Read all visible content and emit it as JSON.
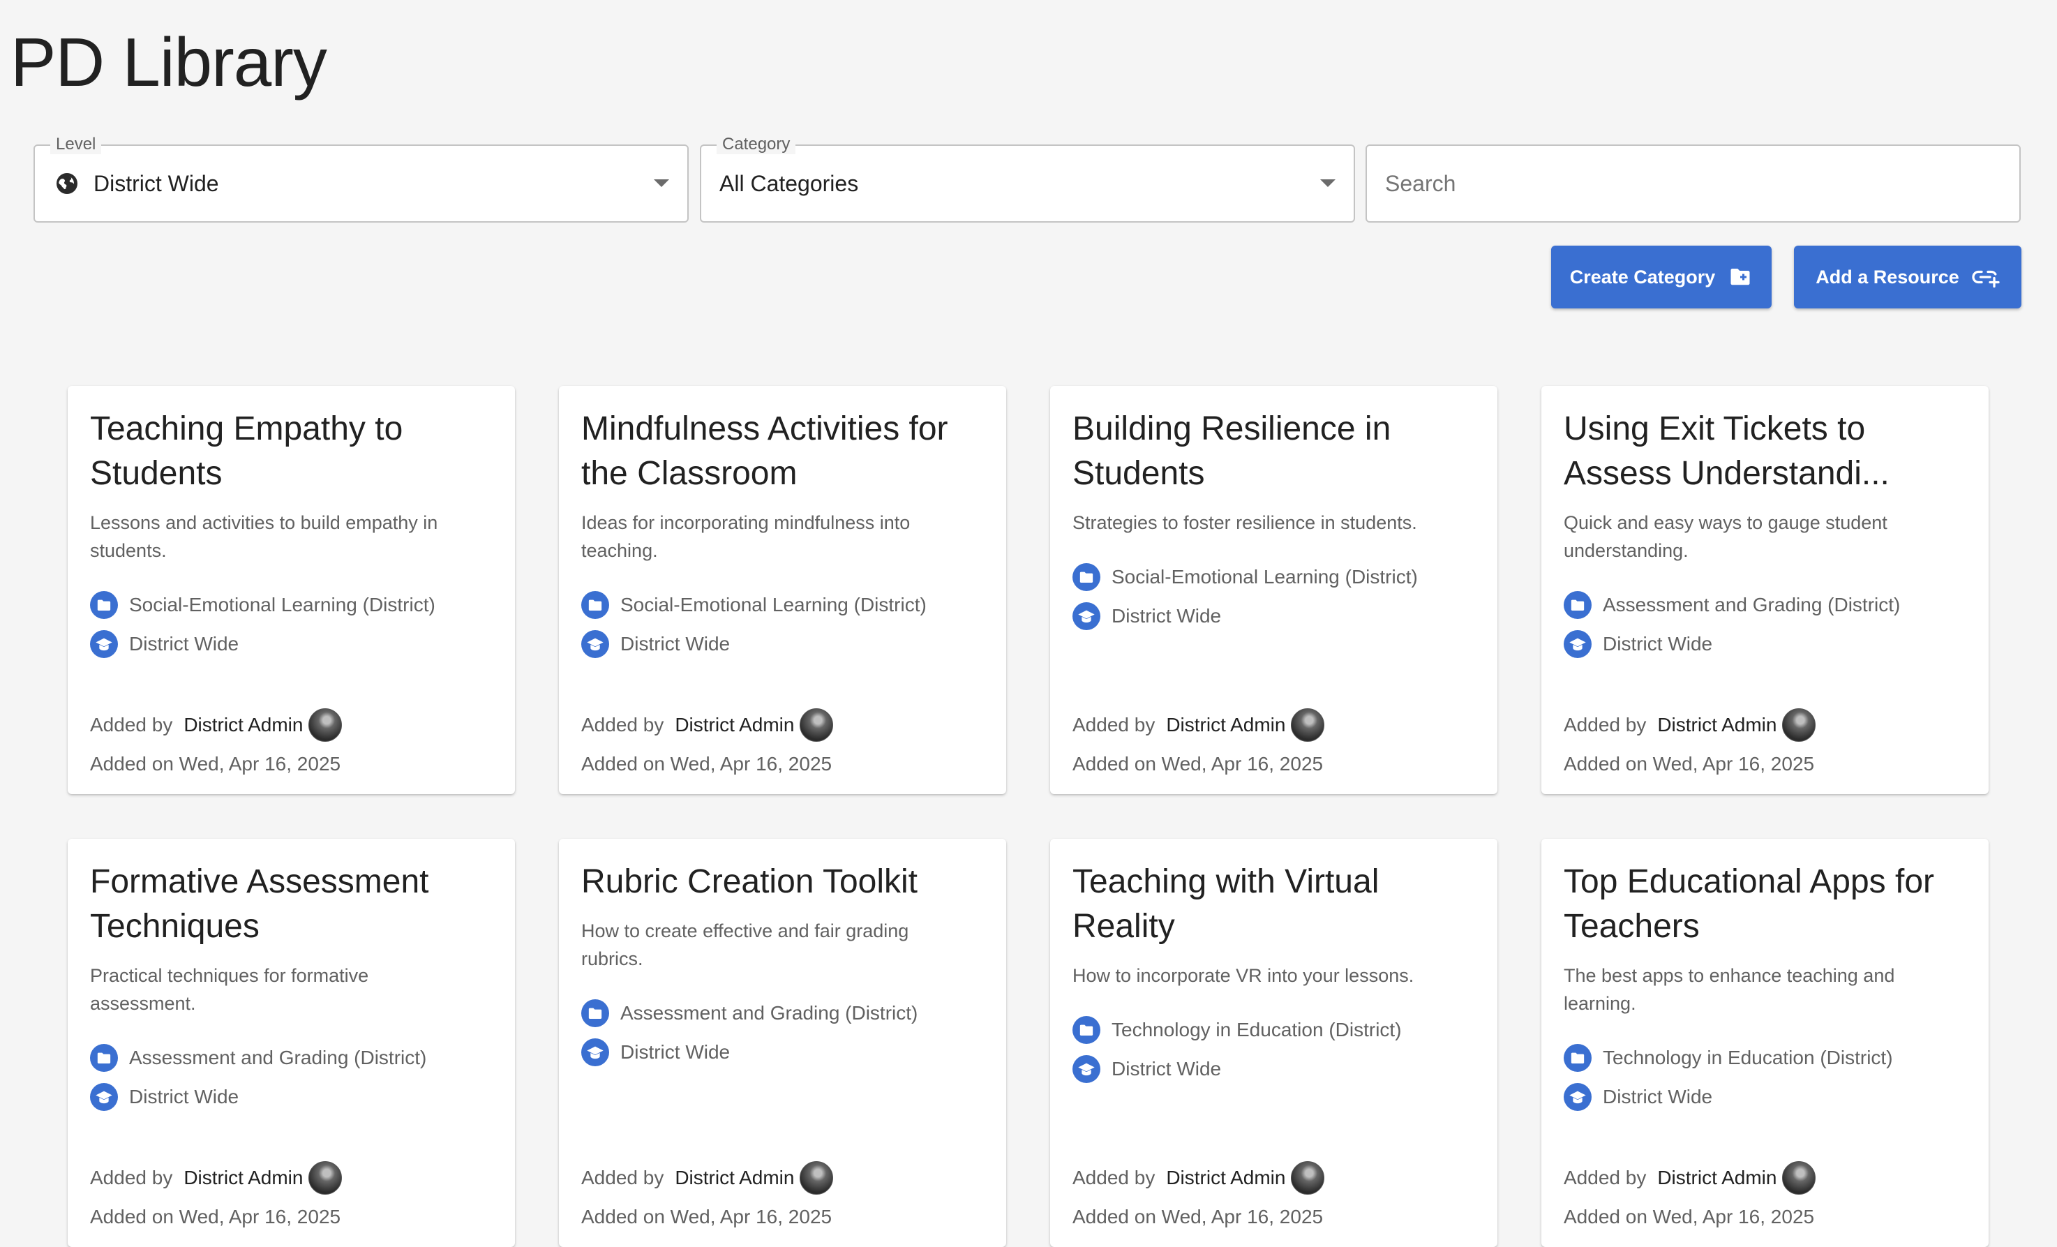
{
  "page": {
    "title": "PD Library"
  },
  "filters": {
    "level": {
      "label": "Level",
      "value": "District Wide"
    },
    "category": {
      "label": "Category",
      "value": "All Categories"
    },
    "search": {
      "placeholder": "Search",
      "value": ""
    }
  },
  "actions": {
    "create_category": "Create Category",
    "add_resource": "Add a Resource"
  },
  "colors": {
    "accent": "#3a6fd1",
    "background": "#f5f5f5"
  },
  "icons": {
    "level": "globe-icon",
    "create_category": "folder-plus-icon",
    "add_resource": "link-plus-icon",
    "category": "folder-icon",
    "level_badge": "graduation-cap-icon"
  },
  "cards": [
    {
      "title": "Teaching Empathy to\nStudents",
      "description": "Lessons and activities to build empathy in\nstudents.",
      "category": "Social-Emotional Learning (District)",
      "level": "District Wide",
      "added_by_label": "Added by",
      "added_by": "District Admin",
      "added_on": "Added on Wed, Apr 16, 2025"
    },
    {
      "title": "Mindfulness Activities for\nthe Classroom",
      "description": "Ideas for incorporating mindfulness into\nteaching.",
      "category": "Social-Emotional Learning (District)",
      "level": "District Wide",
      "added_by_label": "Added by",
      "added_by": "District Admin",
      "added_on": "Added on Wed, Apr 16, 2025"
    },
    {
      "title": "Building Resilience in\nStudents",
      "description": "Strategies to foster resilience in students.",
      "category": "Social-Emotional Learning (District)",
      "level": "District Wide",
      "added_by_label": "Added by",
      "added_by": "District Admin",
      "added_on": "Added on Wed, Apr 16, 2025"
    },
    {
      "title": "Using Exit Tickets to\nAssess Understandi...",
      "description": "Quick and easy ways to gauge student\nunderstanding.",
      "category": "Assessment and Grading (District)",
      "level": "District Wide",
      "added_by_label": "Added by",
      "added_by": "District Admin",
      "added_on": "Added on Wed, Apr 16, 2025"
    },
    {
      "title": "Formative Assessment\nTechniques",
      "description": "Practical techniques for formative\nassessment.",
      "category": "Assessment and Grading (District)",
      "level": "District Wide",
      "added_by_label": "Added by",
      "added_by": "District Admin",
      "added_on": "Added on Wed, Apr 16, 2025"
    },
    {
      "title": "Rubric Creation Toolkit",
      "description": "How to create effective and fair grading\nrubrics.",
      "category": "Assessment and Grading (District)",
      "level": "District Wide",
      "added_by_label": "Added by",
      "added_by": "District Admin",
      "added_on": "Added on Wed, Apr 16, 2025"
    },
    {
      "title": "Teaching with Virtual\nReality",
      "description": "How to incorporate VR into your lessons.",
      "category": "Technology in Education (District)",
      "level": "District Wide",
      "added_by_label": "Added by",
      "added_by": "District Admin",
      "added_on": "Added on Wed, Apr 16, 2025"
    },
    {
      "title": "Top Educational Apps for\nTeachers",
      "description": "The best apps to enhance teaching and\nlearning.",
      "category": "Technology in Education (District)",
      "level": "District Wide",
      "added_by_label": "Added by",
      "added_by": "District Admin",
      "added_on": "Added on Wed, Apr 16, 2025"
    }
  ]
}
